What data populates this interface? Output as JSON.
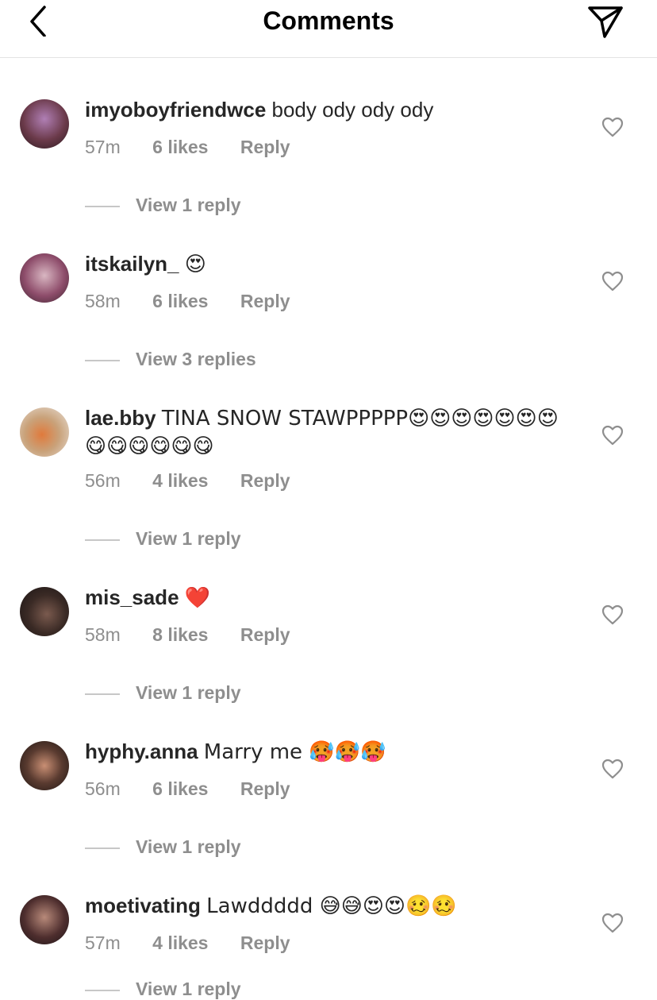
{
  "header": {
    "title": "Comments",
    "back_icon": "chevron-left-icon",
    "send_icon": "paper-plane-icon"
  },
  "comments": [
    {
      "username": "imyoboyfriendwce",
      "text": "body ody ody ody",
      "time": "57m",
      "likes": "6 likes",
      "reply_label": "Reply",
      "view_replies": "View 1 reply"
    },
    {
      "username": "itskailyn_",
      "text": "😍",
      "time": "58m",
      "likes": "6 likes",
      "reply_label": "Reply",
      "view_replies": "View 3 replies"
    },
    {
      "username": "lae.bby",
      "text": "TINA SNOW STAWPPPPP😍😍😍😍😍😍😍😋😋😋😋😋😋",
      "time": "56m",
      "likes": "4 likes",
      "reply_label": "Reply",
      "view_replies": "View 1 reply"
    },
    {
      "username": "mis_sade",
      "text": "❤️",
      "time": "58m",
      "likes": "8 likes",
      "reply_label": "Reply",
      "view_replies": "View 1 reply"
    },
    {
      "username": "hyphy.anna",
      "text": "Marry me 🥵🥵🥵",
      "time": "56m",
      "likes": "6 likes",
      "reply_label": "Reply",
      "view_replies": "View 1 reply"
    },
    {
      "username": "moetivating",
      "text": "Lawddddd 😅😅😍😍🥴🥴",
      "time": "57m",
      "likes": "4 likes",
      "reply_label": "Reply",
      "view_replies": "View 1 reply"
    }
  ],
  "colors": {
    "primary_text": "#262626",
    "secondary_text": "#8e8e8e",
    "divider": "#e3e3e3"
  }
}
